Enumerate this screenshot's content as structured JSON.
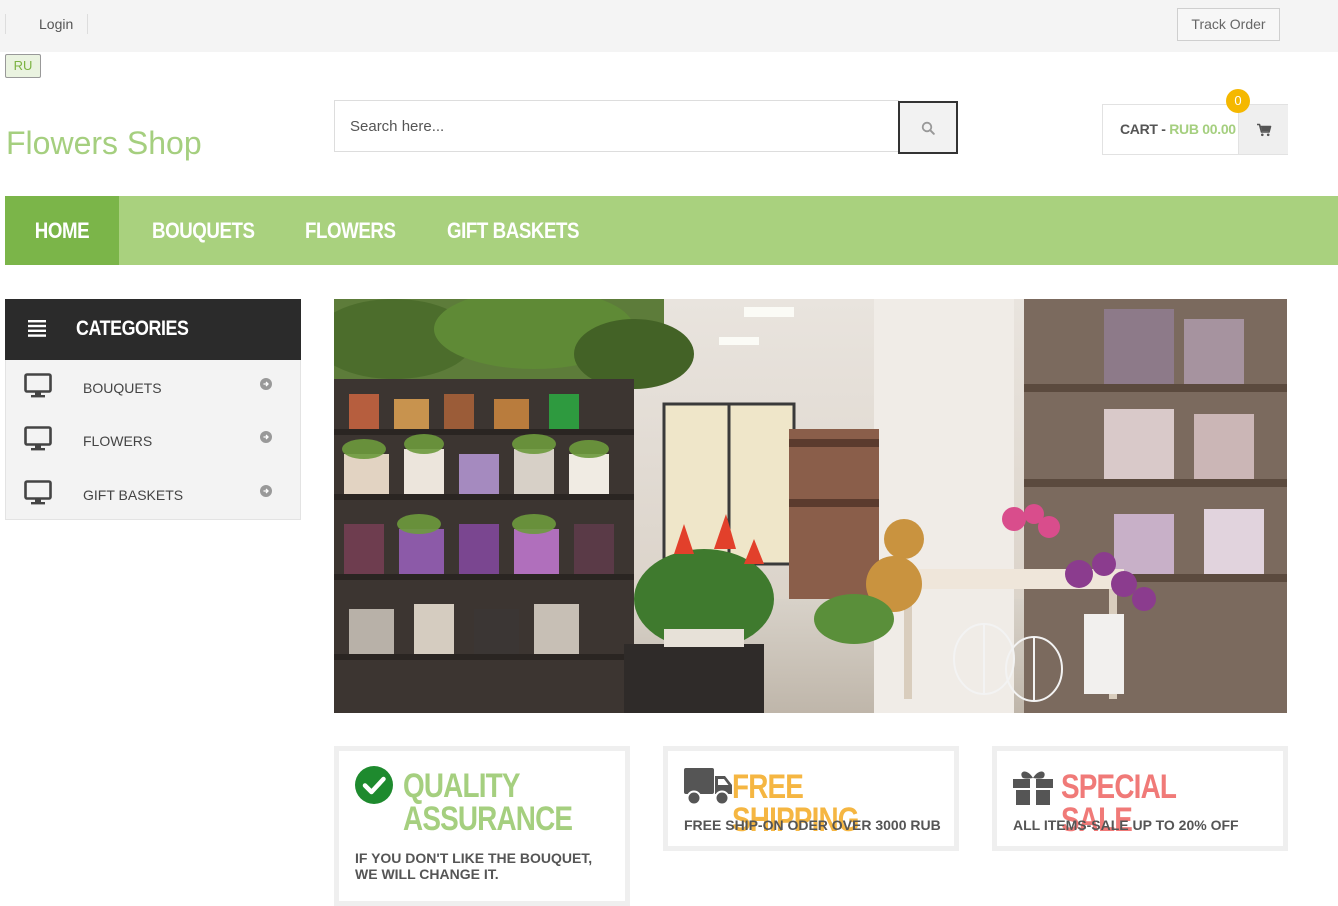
{
  "topbar": {
    "login_label": "Login",
    "track_order_label": "Track Order"
  },
  "language": {
    "label": "RU"
  },
  "site": {
    "logo_text": "Flowers Shop"
  },
  "search": {
    "placeholder": "Search here...",
    "button_icon": "search-icon"
  },
  "cart": {
    "label": "CART - ",
    "amount": "RUB 00.00",
    "count": "0",
    "icon": "cart-icon"
  },
  "nav": {
    "items": [
      {
        "label": "HOME",
        "active": true
      },
      {
        "label": "BOUQUETS",
        "active": false
      },
      {
        "label": "FLOWERS",
        "active": false
      },
      {
        "label": "GIFT BASKETS",
        "active": false
      }
    ]
  },
  "categories": {
    "title": "CATEGORIES",
    "items": [
      {
        "label": "BOUQUETS",
        "icon": "monitor-icon"
      },
      {
        "label": "FLOWERS",
        "icon": "monitor-icon"
      },
      {
        "label": "GIFT BASKETS",
        "icon": "monitor-icon"
      }
    ]
  },
  "features": [
    {
      "title_line1": "QUALITY",
      "title_line2": "ASSURANCE",
      "description": "IF YOU DON'T LIKE THE BOUQUET, WE WILL CHANGE IT.",
      "icon": "check-circle-icon",
      "color": "#a5cf7f"
    },
    {
      "title": "FREE SHIPPING",
      "description": "FREE SHIP-ON ODER OVER 3000 RUB",
      "icon": "truck-icon",
      "color": "#f5b642"
    },
    {
      "title": "SPECIAL SALE",
      "description": "ALL ITEMS-SALE UP TO 20% OFF",
      "icon": "gift-icon",
      "color": "#f07a78"
    }
  ],
  "colors": {
    "brand_green": "#a9d17e",
    "active_green": "#7bb549",
    "dark_header": "#2b2b2b",
    "badge_yellow": "#f5b800"
  }
}
